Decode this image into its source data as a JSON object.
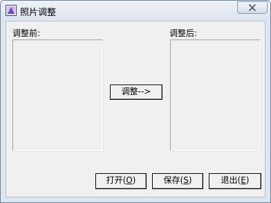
{
  "window": {
    "title": "照片调整"
  },
  "panels": {
    "before_label": "调整前:",
    "after_label": "调整后:"
  },
  "buttons": {
    "adjust": "调整-->",
    "open_prefix": "打开(",
    "open_key": "O",
    "open_suffix": ")",
    "save_prefix": "保存(",
    "save_key": "S",
    "save_suffix": ")",
    "exit_prefix": "退出(",
    "exit_key": "E",
    "exit_suffix": ")"
  },
  "icons": {
    "app": "photo-app-icon",
    "close": "close-icon"
  }
}
